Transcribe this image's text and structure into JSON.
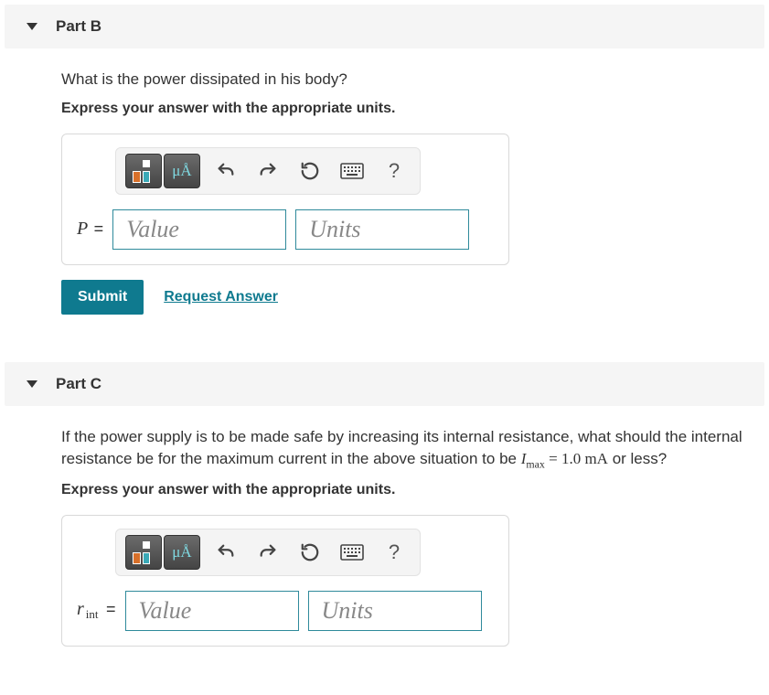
{
  "partB": {
    "title": "Part B",
    "question": "What is the power dissipated in his body?",
    "instruction": "Express your answer with the appropriate units.",
    "variable": "P",
    "valuePlaceholder": "Value",
    "unitsPlaceholder": "Units",
    "submit": "Submit",
    "requestAnswer": "Request Answer"
  },
  "partC": {
    "title": "Part C",
    "question_pre": "If the power supply is to be made safe by increasing its internal resistance, what should the internal resistance be for the maximum current in the above situation to be ",
    "question_eq_var": "I",
    "question_eq_sub": "max",
    "question_eq_val": " = 1.0 mA",
    "question_post": " or less?",
    "instruction": "Express your answer with the appropriate units.",
    "variable": "r",
    "variable_sub": "int",
    "valuePlaceholder": "Value",
    "unitsPlaceholder": "Units"
  },
  "toolbar": {
    "symbols": "μÅ",
    "help": "?"
  }
}
